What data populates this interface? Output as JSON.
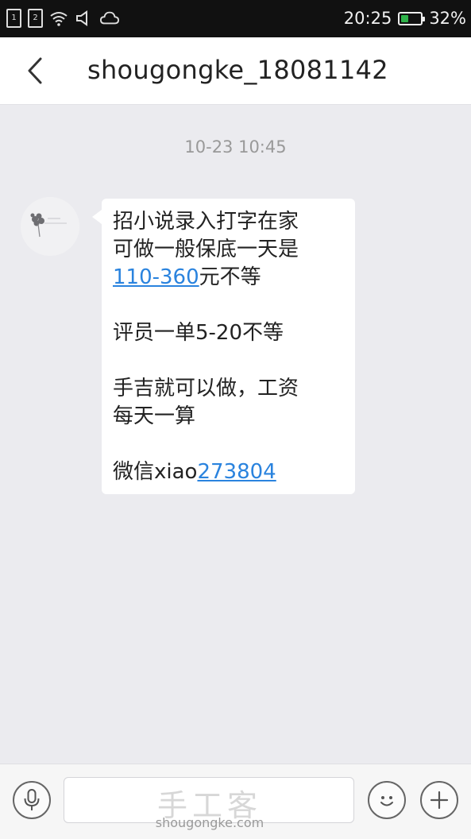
{
  "status_bar": {
    "sim1": "1",
    "sim2": "2",
    "icons": [
      "sim1-icon",
      "sim2-icon",
      "wifi-icon",
      "mute-icon",
      "cloud-icon"
    ],
    "time": "20:25",
    "battery_percent": "32%",
    "battery_level": 0.32,
    "battery_color": "#2fb24a"
  },
  "header": {
    "title": "shougongke_18081142"
  },
  "conversation": {
    "timestamp": "10-23 10:45",
    "message": {
      "line1": "招小说录入打字在家",
      "line2": "可做一般保底一天是",
      "line3_link": "110-360",
      "line3_rest": "元不等",
      "line4": "评员一单5-20不等",
      "line5": "手吉就可以做，工资",
      "line6": "每天一算",
      "line7_prefix": "微信xiao",
      "line7_link": "273804"
    },
    "link_color": "#2a83de"
  },
  "input_bar": {
    "icons": [
      "microphone-icon",
      "emoji-icon",
      "plus-icon"
    ],
    "watermark_main": "手工客",
    "watermark_sub": "shougongke.com"
  }
}
